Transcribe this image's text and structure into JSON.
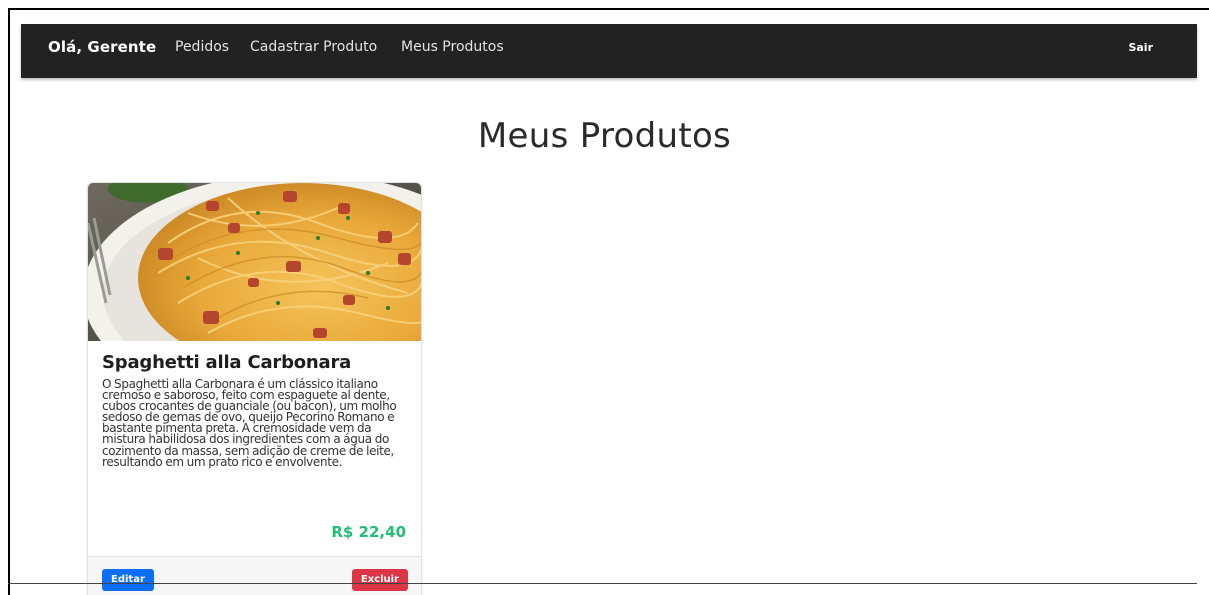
{
  "nav": {
    "brand": "Olá, Gerente",
    "links": [
      "Pedidos",
      "Cadastrar Produto",
      "Meus Produtos"
    ],
    "logout": "Sair"
  },
  "page": {
    "title": "Meus Produtos"
  },
  "products": [
    {
      "name": "Spaghetti alla Carbonara",
      "description": "O Spaghetti alla Carbonara é um clássico italiano cremoso e saboroso, feito com espaguete al dente, cubos crocantes de guanciale (ou bacon), um molho sedoso de gemas de ovo, queijo Pecorino Romano e bastante pimenta preta. A cremosidade vem da mistura habilidosa dos ingredientes com a água do cozimento da massa, sem adição de creme de leite, resultando em um prato rico e envolvente.",
      "price": "R$ 22,40",
      "edit_label": "Editar",
      "delete_label": "Excluir"
    }
  ],
  "colors": {
    "navbar_bg": "#222222",
    "price": "#1fbf74",
    "edit_button": "#0d6efd",
    "delete_button": "#dc3545"
  }
}
